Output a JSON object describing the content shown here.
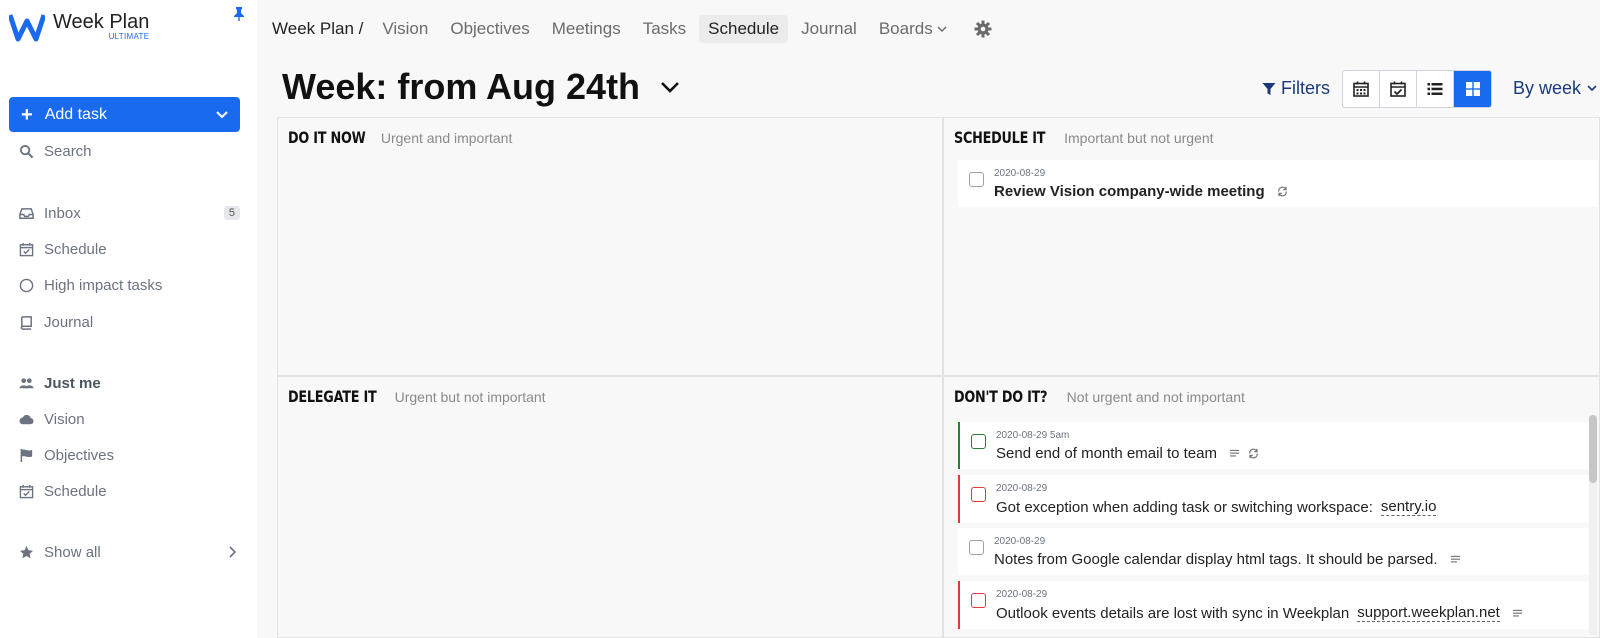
{
  "app": {
    "name": "Week Plan",
    "tier": "ULTIMATE"
  },
  "sidebar": {
    "add_task_label": "Add task",
    "search_label": "Search",
    "items": [
      {
        "label": "Inbox",
        "icon": "inbox-icon",
        "badge": "5"
      },
      {
        "label": "Schedule",
        "icon": "calendar-check-icon"
      },
      {
        "label": "High impact tasks",
        "icon": "circle-icon"
      },
      {
        "label": "Journal",
        "icon": "book-icon"
      }
    ],
    "workspace": {
      "label": "Just me",
      "icon": "users-icon"
    },
    "workspace_items": [
      {
        "label": "Vision",
        "icon": "cloud-icon"
      },
      {
        "label": "Objectives",
        "icon": "flag-icon"
      },
      {
        "label": "Schedule",
        "icon": "calendar-check-icon"
      }
    ],
    "show_all_label": "Show all"
  },
  "topnav": {
    "breadcrumb": "Week Plan /",
    "tabs": [
      {
        "label": "Vision"
      },
      {
        "label": "Objectives"
      },
      {
        "label": "Meetings"
      },
      {
        "label": "Tasks"
      },
      {
        "label": "Schedule",
        "active": true
      },
      {
        "label": "Journal"
      },
      {
        "label": "Boards"
      }
    ]
  },
  "header": {
    "title": "Week: from Aug 24th",
    "filters_label": "Filters",
    "period_label": "By week",
    "views": [
      "calendar-icon",
      "calendar-check-icon",
      "list-icon",
      "grid-icon"
    ],
    "active_view": "grid-icon"
  },
  "quadrants": {
    "q1": {
      "title": "DO IT NOW",
      "subtitle": "Urgent and important"
    },
    "q2": {
      "title": "SCHEDULE IT",
      "subtitle": "Important but not urgent",
      "tasks": [
        {
          "date": "2020-08-29",
          "title": "Review Vision company-wide meeting"
        }
      ]
    },
    "q3": {
      "title": "DELEGATE IT",
      "subtitle": "Urgent but not important"
    },
    "q4": {
      "title": "DON'T DO IT?",
      "subtitle": "Not urgent and not important",
      "tasks": [
        {
          "date": "2020-08-29 5am",
          "title": "Send end of month email to team"
        },
        {
          "date": "2020-08-29",
          "title": "Got exception when adding task or switching workspace:",
          "link": "sentry.io"
        },
        {
          "date": "2020-08-29",
          "title": "Notes from Google calendar display html tags. It should be parsed."
        },
        {
          "date": "2020-08-29",
          "title": "Outlook events details are lost with sync in Weekplan",
          "link": "support.weekplan.net"
        }
      ]
    }
  },
  "colors": {
    "accent": "#1a6af0",
    "nav_text": "#1a3a7a",
    "task_green": "#2e7d32",
    "task_red": "#e53935"
  }
}
